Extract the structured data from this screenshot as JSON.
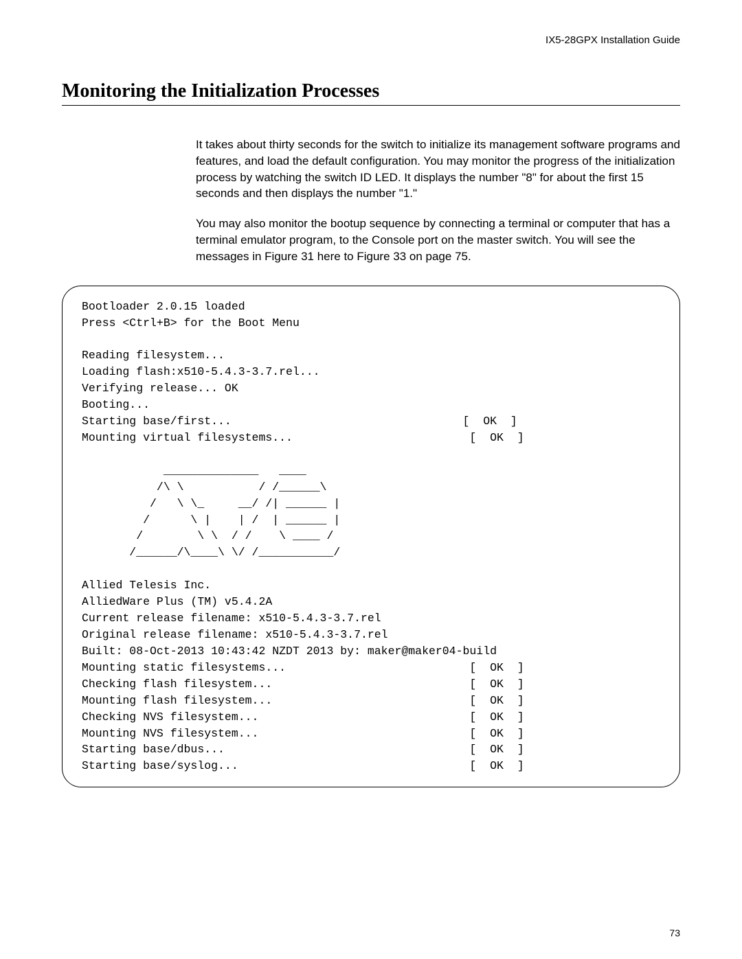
{
  "header": {
    "guide": "IX5-28GPX Installation Guide"
  },
  "title": "Monitoring the Initialization Processes",
  "intro": {
    "p1": "It takes about thirty seconds for the switch to initialize its management software programs and features, and load the default configuration. You may monitor the progress of the initialization process by watching the switch ID LED. It displays the number \"8\" for about the first 15 seconds and then displays the number \"1.\"",
    "p2": "You may also monitor the bootup sequence by connecting a terminal or computer that has a terminal emulator program, to the Console port on the master switch. You will see the messages in Figure 31 here to Figure 33 on page 75."
  },
  "terminal": "Bootloader 2.0.15 loaded\nPress <Ctrl+B> for the Boot Menu\n\nReading filesystem...\nLoading flash:x510-5.4.3-3.7.rel...\nVerifying release... OK\nBooting...\nStarting base/first...                                  [  OK  ]\nMounting virtual filesystems...                          [  OK  ]\n\n            ______________   ____\n           /\\ \\           / /______\\\n          /   \\ \\_     __/ /| ______ |\n         /      \\ |    | /  | ______ |\n        /        \\ \\  / /    \\ ____ /\n       /______/\\____\\ \\/ /___________/\n\nAllied Telesis Inc.\nAlliedWare Plus (TM) v5.4.2A\nCurrent release filename: x510-5.4.3-3.7.rel\nOriginal release filename: x510-5.4.3-3.7.rel\nBuilt: 08-Oct-2013 10:43:42 NZDT 2013 by: maker@maker04-build\nMounting static filesystems...                           [  OK  ]\nChecking flash filesystem...                             [  OK  ]\nMounting flash filesystem...                             [  OK  ]\nChecking NVS filesystem...                               [  OK  ]\nMounting NVS filesystem...                               [  OK  ]\nStarting base/dbus...                                    [  OK  ]\nStarting base/syslog...                                  [  OK  ]",
  "page_number": "73"
}
